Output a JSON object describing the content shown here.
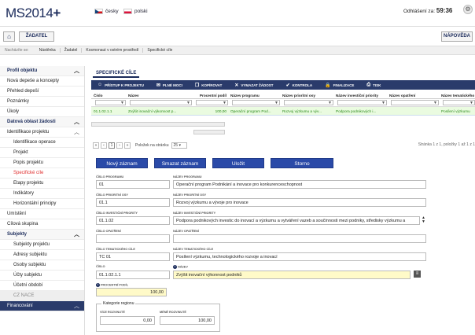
{
  "header": {
    "logo_main": "MS2014",
    "logo_plus": "+",
    "lang_cz": "česky",
    "lang_pl": "polski",
    "logout_label": "Odhlášení za:",
    "logout_time": "59:36"
  },
  "nav": {
    "zadatel": "ŽADATEL",
    "napoveda": "NÁPOVĚDA"
  },
  "breadcrumb": {
    "label": "Nacházíte se:",
    "items": [
      "Nástěnka",
      "Žadatel",
      "Kosmonaut v ostrém prostředí",
      "Specifické cíle"
    ]
  },
  "sidebar": {
    "items": [
      {
        "label": "Profil objektu",
        "type": "head"
      },
      {
        "label": "Nová depeše a koncepty",
        "type": "item"
      },
      {
        "label": "Přehled depeší",
        "type": "item"
      },
      {
        "label": "Poznámky",
        "type": "item"
      },
      {
        "label": "Úkoly",
        "type": "item"
      },
      {
        "label": "Datová oblast žádosti",
        "type": "head"
      },
      {
        "label": "Identifikace projektu",
        "type": "item"
      },
      {
        "label": "Identifikace operace",
        "type": "sub"
      },
      {
        "label": "Projekt",
        "type": "sub"
      },
      {
        "label": "Popis projektu",
        "type": "sub"
      },
      {
        "label": "Specifické cíle",
        "type": "sub"
      },
      {
        "label": "Etapy projektu",
        "type": "sub"
      },
      {
        "label": "Indikátory",
        "type": "sub"
      },
      {
        "label": "Horizontální principy",
        "type": "sub"
      },
      {
        "label": "Umístění",
        "type": "item"
      },
      {
        "label": "Cílová skupina",
        "type": "item"
      },
      {
        "label": "Subjekty",
        "type": "head"
      },
      {
        "label": "Subjekty projektu",
        "type": "sub"
      },
      {
        "label": "Adresy subjektu",
        "type": "sub"
      },
      {
        "label": "Osoby subjektu",
        "type": "sub"
      },
      {
        "label": "Účty subjektu",
        "type": "sub"
      },
      {
        "label": "Účetní období",
        "type": "sub"
      },
      {
        "label": "CZ NACE",
        "type": "sub"
      },
      {
        "label": "Financování",
        "type": "head"
      }
    ]
  },
  "main": {
    "tab_title": "SPECIFICKÉ CÍLE",
    "toolbar": [
      "PŘÍSTUP K PROJEKTU",
      "PLNÉ MOCI",
      "KOPÍROVAT",
      "VYMAZAT ŽÁDOST",
      "KONTROLA",
      "FINALIZACE",
      "TISK"
    ],
    "toolbar_icons": [
      "people-icon",
      "envelope-icon",
      "copy-icon",
      "delete-icon",
      "check-icon",
      "lock-icon",
      "printer-icon"
    ],
    "grid": {
      "headers": [
        "Číslo",
        "Název",
        "Procentní podíl",
        "Název programu",
        "Název prioritní osy",
        "Název investiční priority",
        "Název opatření",
        "Název tematického"
      ],
      "row": [
        "01.1.02.1.1",
        "Zvýšit inovační výkonnost p...",
        "100,00",
        "Operační program Pod...",
        "Rozvoj výzkumu a výv...",
        "Podpora podnikových i...",
        "",
        "Posílení výzkumu"
      ]
    },
    "pager": {
      "current": "1",
      "size_label": "Položek na stránku",
      "size": "25",
      "summary": "Stránka 1 z 1, položky 1 až 1 z 1"
    },
    "buttons": {
      "new": "Nový záznam",
      "delete": "Smazat záznam",
      "save": "Uložit",
      "cancel": "Storno"
    },
    "form": {
      "cislo_programu_label": "ČÍSLO PROGRAMU",
      "cislo_programu": "01",
      "nazev_programu_label": "NÁZEV PROGRAMU",
      "nazev_programu": "Operační program Podnikání a inovace pro konkurenceschopnost",
      "cislo_osy_label": "ČÍSLO PRIORITNÍ OSY",
      "cislo_osy": "01.1",
      "nazev_osy_label": "NÁZEV PRIORITNÍ OSY",
      "nazev_osy": "Rozvoj výzkumu a vývoje pro inovace",
      "cislo_priority_label": "ČÍSLO INVESTIČNÍ PRIORITY",
      "cislo_priority": "01.1.02",
      "nazev_priority_label": "NÁZEV INVESTIČNÍ PRIORITY",
      "nazev_priority": "Podpora podnikových investic do inovací a výzkumu a vytváření vazeb a součinnosti mezi podniky, středisky výzkumu a",
      "cislo_opatreni_label": "ČÍSLO OPATŘENÍ",
      "cislo_opatreni": "",
      "nazev_opatreni_label": "NÁZEV OPATŘENÍ",
      "nazev_opatreni": "",
      "cislo_tc_label": "ČÍSLO TEMATICKÉHO CÍLE",
      "cislo_tc": "TC 01",
      "nazev_tc_label": "NÁZEV TEMATICKÉHO CÍLE",
      "nazev_tc": "Posílení výzkumu, technologického rozvoje a inovací",
      "cislo_label": "ČÍSLO",
      "cislo": "01.1.02.1.1",
      "nazev_label": "NÁZEV",
      "nazev": "Zvýšit inovační výkonnost podniků",
      "podil_label": "PROCENTNÍ PODÍL",
      "podil": "100,00",
      "kategorie_label": "Kategorie regionu",
      "vice_label": "VÍCE ROZVINUTÉ",
      "vice": "0,00",
      "mene_label": "MÉNĚ ROZVINUTÉ",
      "mene": "100,00"
    }
  }
}
